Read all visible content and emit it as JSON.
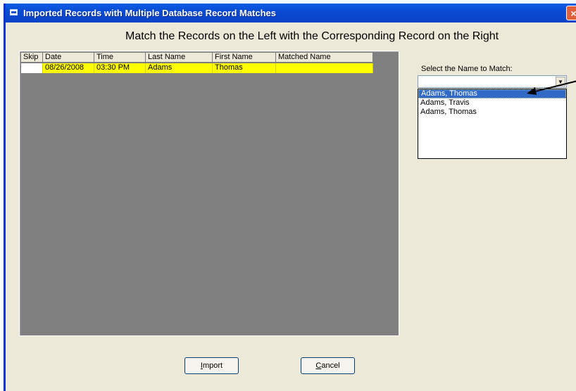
{
  "window": {
    "title": "Imported Records with Multiple Database Record Matches",
    "close_label": "×"
  },
  "heading": "Match the Records on the Left with the Corresponding Record on the Right",
  "grid": {
    "columns": [
      "Skip",
      "Date",
      "Time",
      "Last Name",
      "First Name",
      "Matched Name"
    ],
    "rows": [
      {
        "skip": "",
        "date": "08/26/2008",
        "time": "03:30 PM",
        "last": "Adams",
        "first": "Thomas",
        "matched": ""
      }
    ],
    "row_highlight_color": "#ffff00"
  },
  "match_panel": {
    "label": "Select the Name to Match:",
    "dropdown_value": "",
    "list_items": [
      "Adams, Thomas",
      "Adams, Travis",
      "Adams, Thomas"
    ],
    "selected_index": 0
  },
  "buttons": {
    "import_first": "I",
    "import_rest": "mport",
    "cancel_first": "C",
    "cancel_rest": "ancel"
  }
}
